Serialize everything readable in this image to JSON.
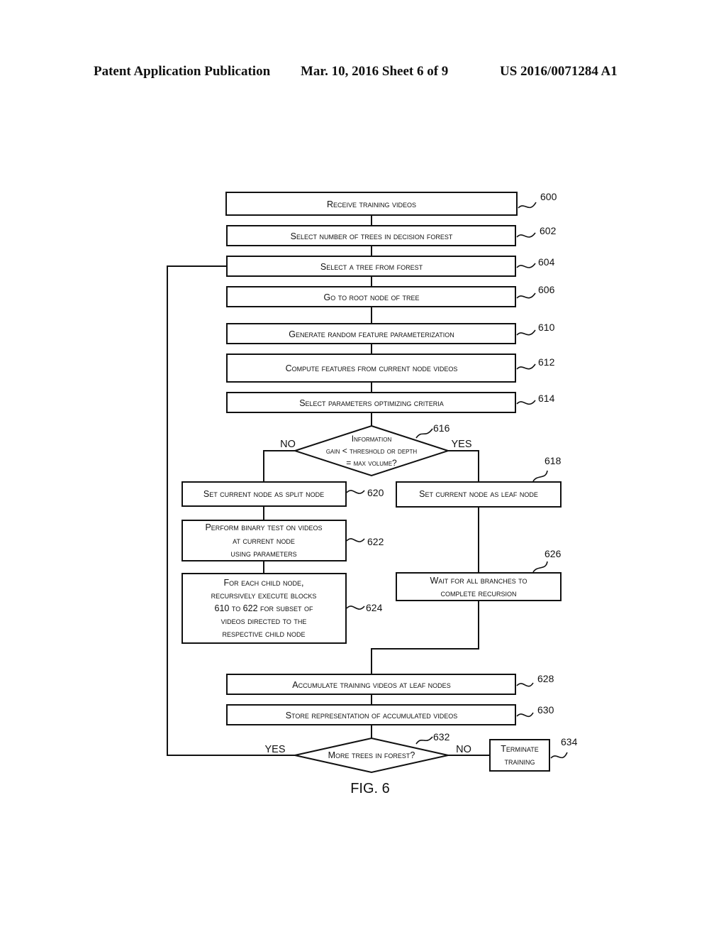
{
  "header": {
    "publication": "Patent Application Publication",
    "date_sheet": "Mar. 10, 2016  Sheet 6 of 9",
    "number": "US 2016/0071284 A1"
  },
  "steps": {
    "s600": {
      "text": "Receive training videos",
      "ref": "600"
    },
    "s602": {
      "text": "Select number of trees in decision forest",
      "ref": "602"
    },
    "s604": {
      "text": "Select a tree from forest",
      "ref": "604"
    },
    "s606": {
      "text": "Go to root node of tree",
      "ref": "606"
    },
    "s610": {
      "text": "Generate random feature parameterization",
      "ref": "610"
    },
    "s612": {
      "text": "Compute features from current node videos",
      "ref": "612"
    },
    "s614": {
      "text": "Select parameters optimizing criteria",
      "ref": "614"
    },
    "s616": {
      "lines": [
        "Information",
        "gain < threshold or depth",
        "= max volume?"
      ],
      "ref": "616",
      "no": "NO",
      "yes": "YES"
    },
    "s618": {
      "text": "Set current node as leaf node",
      "ref": "618"
    },
    "s620": {
      "text": "Set current node as split node",
      "ref": "620"
    },
    "s622": {
      "lines": [
        "Perform binary test on videos",
        "at current node",
        "using parameters"
      ],
      "ref": "622"
    },
    "s624": {
      "lines": [
        "For each child node,",
        "recursively execute blocks",
        "610 to 622 for subset of",
        "videos directed to the",
        "respective child node"
      ],
      "ref": "624"
    },
    "s626": {
      "lines": [
        "Wait for all branches to",
        "complete recursion"
      ],
      "ref": "626"
    },
    "s628": {
      "text": "Accumulate training videos at leaf nodes",
      "ref": "628"
    },
    "s630": {
      "text": "Store representation of accumulated videos",
      "ref": "630"
    },
    "s632": {
      "text": "More trees in forest?",
      "ref": "632",
      "yes": "YES",
      "no": "NO"
    },
    "s634": {
      "lines": [
        "Terminate",
        "training"
      ],
      "ref": "634"
    }
  },
  "figure_label": "FIG. 6"
}
